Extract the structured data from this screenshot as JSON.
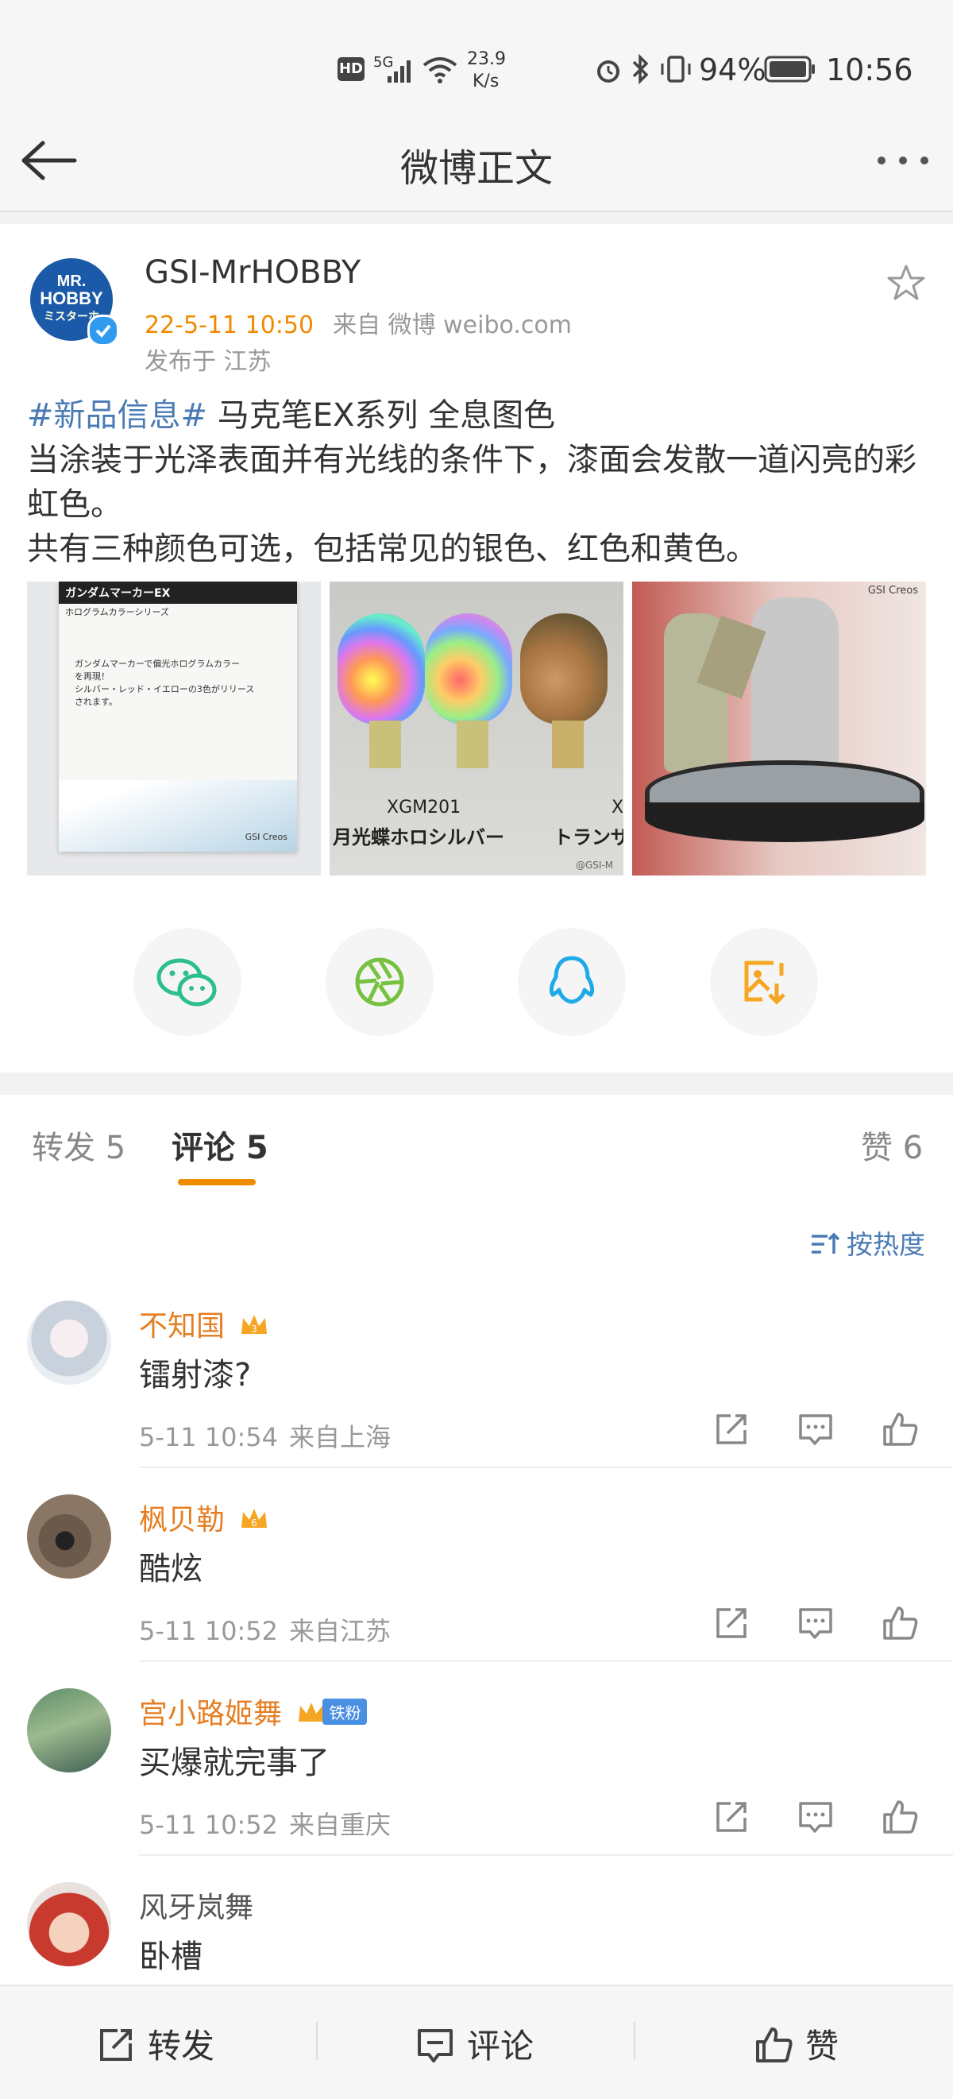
{
  "status_bar": {
    "hd": "HD",
    "net": "5G",
    "speed_value": "23.9",
    "speed_unit": "K/s",
    "battery": "94%",
    "time": "10:56"
  },
  "nav": {
    "title": "微博正文"
  },
  "post": {
    "author": "GSI-MrHOBBY",
    "avatar_text": [
      "MR.",
      "HOBBY",
      "ミスターホ"
    ],
    "time": "22-5-11 10:50",
    "source": "来自 微博 weibo.com",
    "location": "发布于 江苏",
    "hashtag": "#新品信息#",
    "line1_rest": " 马克笔EX系列 全息图色",
    "line2": "当涂装于光泽表面并有光线的条件下，漆面会发散一道闪亮的彩虹色。",
    "line3": "共有三种颜色可选，包括常见的银色、红色和黄色。",
    "images": [
      {
        "t1": "ガンダムマーカーEX",
        "t2": "ホログラムカラーシリーズ",
        "t3": "ガンダムマーカーで偏光ホログラムカラー",
        "t4": "を再現！",
        "t5": "シルバー・レッド・イエローの3色がリリース",
        "t6": "されます。",
        "brand": "GSI Creos"
      },
      {
        "code": "XGM201",
        "label": "月光蝶ホロシルバー",
        "label2": "トランザ",
        "code2": "X",
        "wm": "@GSI-M"
      },
      {
        "brand": "GSI Creos"
      }
    ]
  },
  "tabs": {
    "repost": "转发 5",
    "comment": "评论 5",
    "like": "赞 6",
    "sort": "按热度"
  },
  "comments": [
    {
      "name": "不知国",
      "badge": "3",
      "text": "镭射漆?",
      "time": "5-11 10:54",
      "loc": "来自上海"
    },
    {
      "name": "枫贝勒",
      "badge": "6",
      "text": "酷炫",
      "time": "5-11 10:52",
      "loc": "来自江苏"
    },
    {
      "name": "宫小路姬舞",
      "badge": "",
      "fan": "铁粉",
      "text": "买爆就完事了",
      "time": "5-11 10:52",
      "loc": "来自重庆"
    },
    {
      "name": "风牙岚舞",
      "text": "卧槽"
    }
  ],
  "bottom_bar": {
    "repost": "转发",
    "comment": "评论",
    "like": "赞"
  },
  "colors": {
    "accent": "#f08a00",
    "link": "#4a7bb5",
    "name": "#e67e22"
  }
}
